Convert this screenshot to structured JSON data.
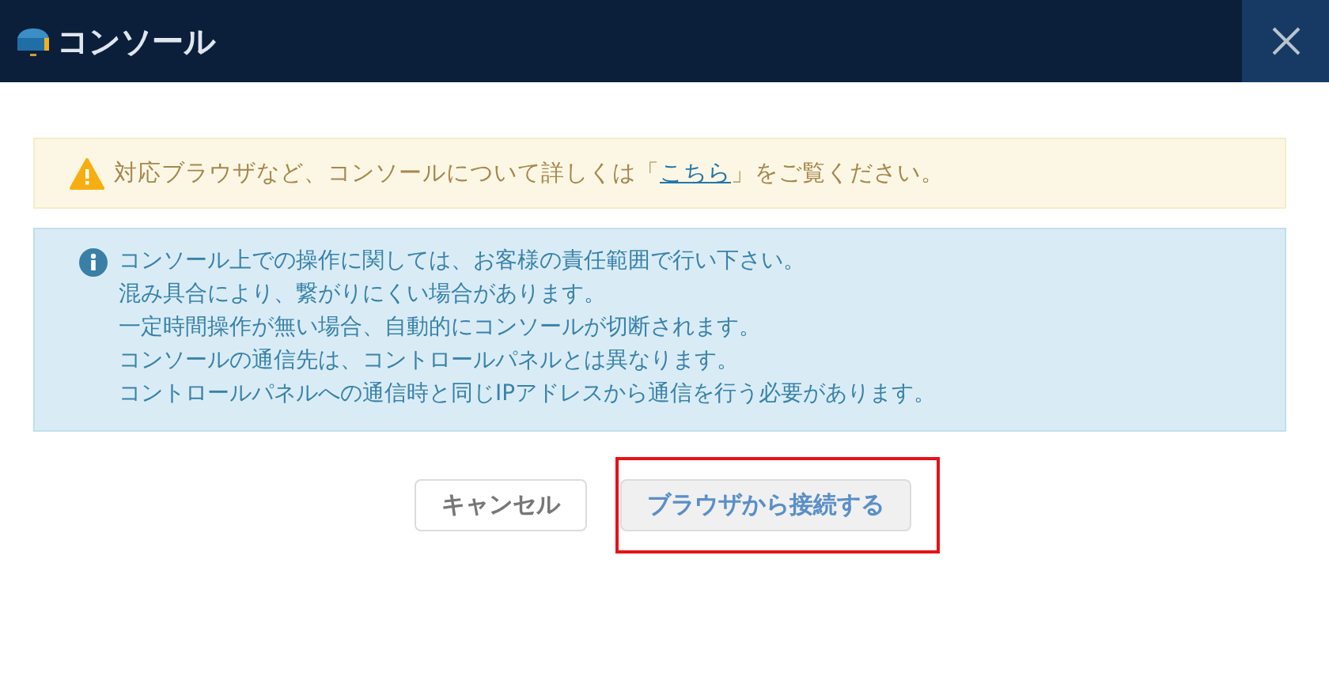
{
  "window": {
    "title": "コンソール"
  },
  "warning": {
    "before": "対応ブラウザなど、コンソールについて詳しくは「",
    "link": "こちら",
    "after": "」をご覧ください。"
  },
  "info": {
    "lines": [
      "コンソール上での操作に関しては、お客様の責任範囲で行い下さい。",
      "混み具合により、繋がりにくい場合があります。",
      "一定時間操作が無い場合、自動的にコンソールが切断されます。",
      "コンソールの通信先は、コントロールパネルとは異なります。",
      "コントロールパネルへの通信時と同じIPアドレスから通信を行う必要があります。"
    ]
  },
  "buttons": [
    {
      "label": "キャンセル",
      "kind": "cancel",
      "highlighted": false
    },
    {
      "label": "ブラウザから接続する",
      "kind": "primary",
      "highlighted": true
    }
  ]
}
